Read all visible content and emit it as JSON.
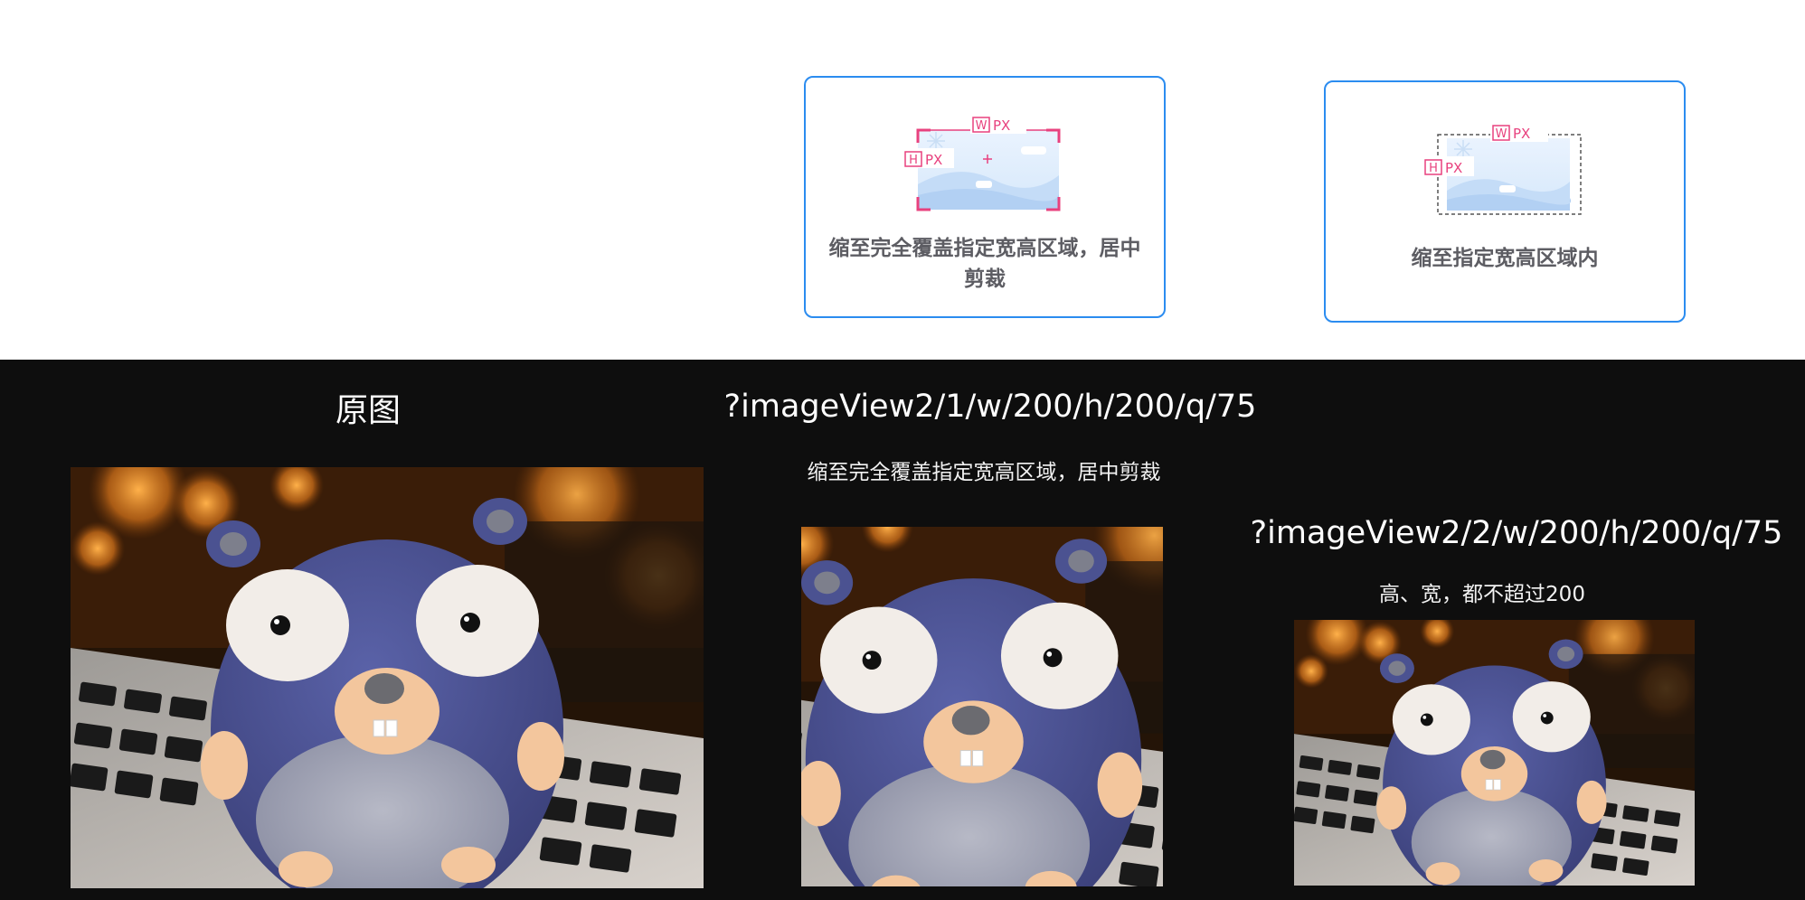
{
  "cards": [
    {
      "label": "缩至完全覆盖指定宽高区域，居中剪裁",
      "w_tag": "W",
      "h_tag": "H",
      "unit": "PX",
      "style": "cover-crop",
      "selected": true
    },
    {
      "label": "缩至指定宽高区域内",
      "w_tag": "W",
      "h_tag": "H",
      "unit": "PX",
      "style": "contain",
      "selected": true
    }
  ],
  "examples": {
    "original": {
      "title": "原图",
      "image": "gopher-plush-photo"
    },
    "mode1": {
      "title": "?imageView2/1/w/200/h/200/q/75",
      "caption": "缩至完全覆盖指定宽高区域，居中剪裁",
      "image": "gopher-plush-photo-cropped"
    },
    "mode2": {
      "title": "?imageView2/2/w/200/h/200/q/75",
      "caption": "高、宽，都不超过200",
      "image": "gopher-plush-photo-contained"
    }
  },
  "colors": {
    "card_border": "#2b8cf0",
    "tag_pink": "#e8417e",
    "dark_bg": "#0e0e0e",
    "label_gray": "#5d5d63"
  }
}
